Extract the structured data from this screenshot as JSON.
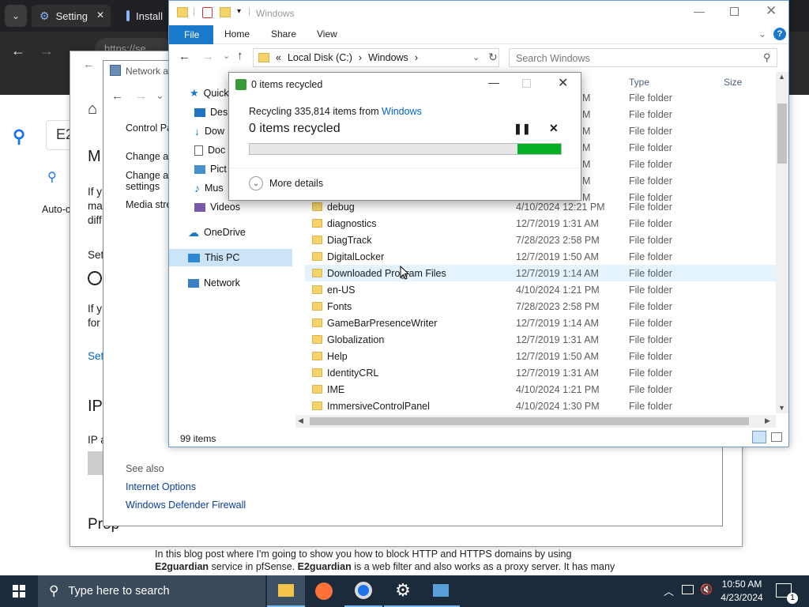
{
  "browser": {
    "tabs": [
      {
        "label": "Setting",
        "icon": "gear-icon",
        "close": "✕"
      },
      {
        "label": "Install",
        "icon": "search-icon"
      }
    ],
    "address": "https://se"
  },
  "blog": {
    "search_value": "E2",
    "heading_fragment": "M",
    "text1": "If y",
    "text2": "ma",
    "text3": "diff",
    "auto_label": "Auto-c",
    "set_label": "Set",
    "ifyou": "If y",
    "for": "for",
    "set_link": "Set",
    "ip_heading": "IP",
    "ip_label": "IP a",
    "prop": "Prop",
    "paragraph_line1": "In this blog post where I'm going to show you how to block HTTP and HTTPS domains by using",
    "paragraph_line2_bold": "E2guardian",
    "paragraph_line2_mid": " service in pfSense. ",
    "paragraph_line2_bold2": "E2guardian",
    "paragraph_line2_end": " is a web filter and also works as a proxy server. It has many"
  },
  "network_window": {
    "title": "Network a",
    "nav": {
      "back": "←",
      "forward": "→",
      "down": "⌄"
    },
    "links": [
      "Control Pa",
      "Change ac",
      "Change ac",
      "settings",
      "Media stre"
    ],
    "see_also": "See also",
    "see_links": [
      "Internet Options",
      "Windows Defender Firewall"
    ]
  },
  "explorer": {
    "title": "Windows",
    "ribbon_tabs": [
      "File",
      "Home",
      "Share",
      "View"
    ],
    "breadcrumb": [
      "«",
      "Local Disk (C:)",
      "›",
      "Windows",
      "›"
    ],
    "search_placeholder": "Search Windows",
    "columns": {
      "type": "Type",
      "size": "Size"
    },
    "nav_items": [
      {
        "label": "Quick",
        "icon": "star-icon"
      },
      {
        "label": "Desk",
        "icon": "desktop-icon"
      },
      {
        "label": "Dow",
        "icon": "download-icon"
      },
      {
        "label": "Doc",
        "icon": "document-icon"
      },
      {
        "label": "Pict",
        "icon": "pictures-icon"
      },
      {
        "label": "Mus",
        "icon": "music-icon"
      },
      {
        "label": "Videos",
        "icon": "videos-icon"
      },
      {
        "label": "OneDrive",
        "icon": "cloud-icon"
      },
      {
        "label": "This PC",
        "icon": "computer-icon"
      },
      {
        "label": "Network",
        "icon": "network-icon"
      }
    ],
    "hidden_rows_types": [
      "File folder",
      "File folder",
      "File folder",
      "File folder",
      "File folder",
      "File folder",
      "File folder"
    ],
    "hidden_rows_times": [
      "M",
      "M",
      "M",
      "M",
      "M",
      "M",
      "M"
    ],
    "rows": [
      {
        "name": "debug",
        "date": "4/10/2024 12:21 PM",
        "type": "File folder"
      },
      {
        "name": "diagnostics",
        "date": "12/7/2019 1:31 AM",
        "type": "File folder"
      },
      {
        "name": "DiagTrack",
        "date": "7/28/2023 2:58 PM",
        "type": "File folder"
      },
      {
        "name": "DigitalLocker",
        "date": "12/7/2019 1:50 AM",
        "type": "File folder"
      },
      {
        "name": "Downloaded Program Files",
        "date": "12/7/2019 1:14 AM",
        "type": "File folder"
      },
      {
        "name": "en-US",
        "date": "4/10/2024 1:21 PM",
        "type": "File folder"
      },
      {
        "name": "Fonts",
        "date": "7/28/2023 2:58 PM",
        "type": "File folder"
      },
      {
        "name": "GameBarPresenceWriter",
        "date": "12/7/2019 1:14 AM",
        "type": "File folder"
      },
      {
        "name": "Globalization",
        "date": "12/7/2019 1:31 AM",
        "type": "File folder"
      },
      {
        "name": "Help",
        "date": "12/7/2019 1:50 AM",
        "type": "File folder"
      },
      {
        "name": "IdentityCRL",
        "date": "12/7/2019 1:31 AM",
        "type": "File folder"
      },
      {
        "name": "IME",
        "date": "4/10/2024 1:21 PM",
        "type": "File folder"
      },
      {
        "name": "ImmersiveControlPanel",
        "date": "4/10/2024 1:30 PM",
        "type": "File folder"
      }
    ],
    "status": "99 items"
  },
  "dialog": {
    "title": "0 items recycled",
    "line_prefix": "Recycling 335,814 items from ",
    "line_link": "Windows",
    "status": "0 items recycled",
    "progress": 0.14,
    "more_details": "More details",
    "colors": {
      "progress": "#06b025",
      "link": "#0066cc"
    }
  },
  "taskbar": {
    "search_placeholder": "Type here to search",
    "time": "10:50 AM",
    "date": "4/23/2024",
    "notification_count": "1"
  }
}
